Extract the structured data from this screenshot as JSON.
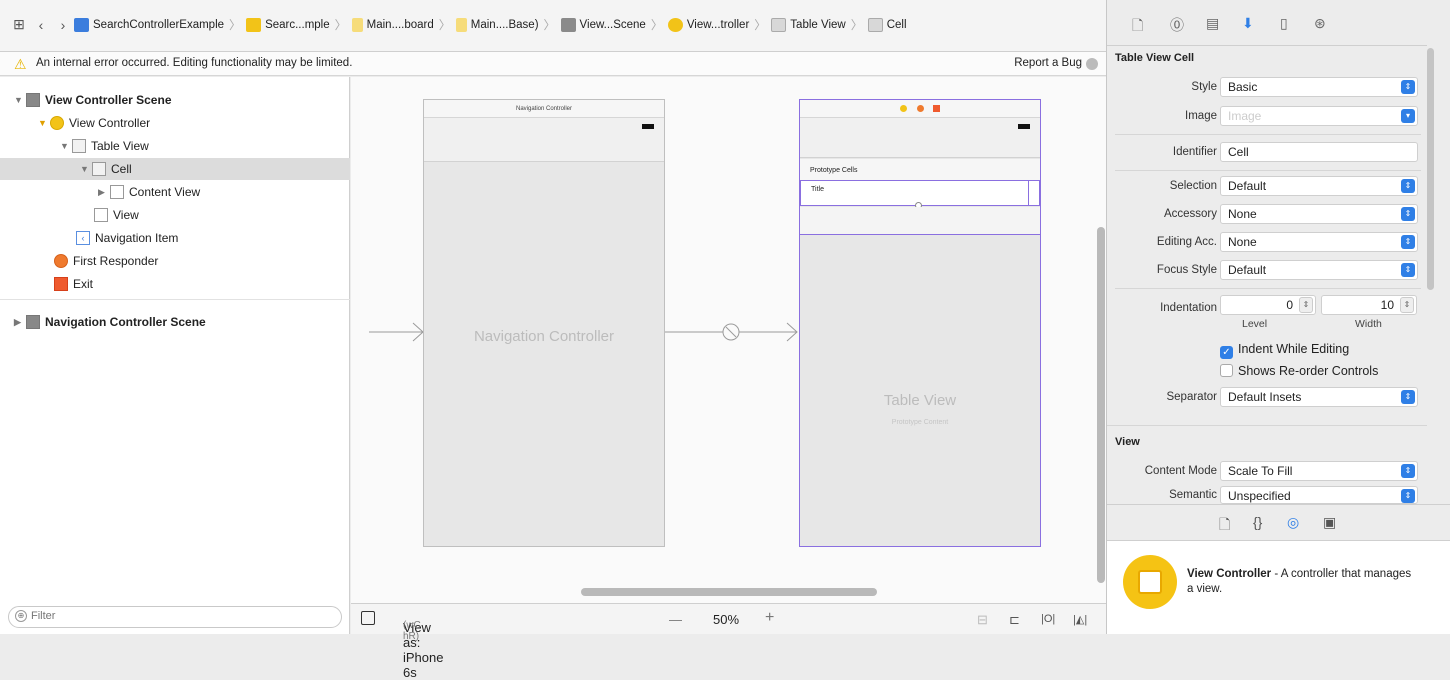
{
  "jumpbar": {
    "crumbs": [
      {
        "label": "SearchControllerExample",
        "color": "#3b7ddd"
      },
      {
        "label": "Searc...mple",
        "color": "#f2c318"
      },
      {
        "label": "Main....board",
        "color": "#f6dc7a"
      },
      {
        "label": "Main....Base)",
        "color": "#f6dc7a"
      },
      {
        "label": "View...Scene",
        "color": "#8a8a8a"
      },
      {
        "label": "View...troller",
        "color": "#f2c318"
      },
      {
        "label": "Table View",
        "color": "#d8d8d8"
      },
      {
        "label": "Cell",
        "color": "#d8d8d8"
      }
    ]
  },
  "warning": {
    "message": "An internal error occurred. Editing functionality may be limited.",
    "report": "Report a Bug"
  },
  "outline": {
    "items": [
      {
        "label": "View Controller Scene",
        "bold": true
      },
      {
        "label": "View Controller"
      },
      {
        "label": "Table View"
      },
      {
        "label": "Cell",
        "selected": true
      },
      {
        "label": "Content View"
      },
      {
        "label": "View"
      },
      {
        "label": "Navigation Item"
      },
      {
        "label": "First Responder"
      },
      {
        "label": "Exit"
      },
      {
        "label": "Navigation Controller Scene",
        "bold": true
      }
    ],
    "filter_placeholder": "Filter"
  },
  "canvas": {
    "nav_scene_title": "Navigation Controller",
    "nav_scene_label": "Navigation Controller",
    "prototype_cells": "Prototype Cells",
    "cell_title": "Title",
    "table_label": "Table View",
    "table_sub": "Prototype Content"
  },
  "bottombar": {
    "view_as": "View as: iPhone 6s",
    "size_class": "(wC hR)",
    "zoom_minus": "—",
    "zoom": "50%",
    "zoom_plus": "+"
  },
  "inspector": {
    "section_cell": "Table View Cell",
    "style_label": "Style",
    "style_value": "Basic",
    "image_label": "Image",
    "image_placeholder": "Image",
    "identifier_label": "Identifier",
    "identifier_value": "Cell",
    "selection_label": "Selection",
    "selection_value": "Default",
    "accessory_label": "Accessory",
    "accessory_value": "None",
    "editacc_label": "Editing Acc.",
    "editacc_value": "None",
    "focus_label": "Focus Style",
    "focus_value": "Default",
    "indent_label": "Indentation",
    "indent_level": "0",
    "indent_width": "10",
    "level_caption": "Level",
    "width_caption": "Width",
    "indent_while_editing": "Indent While Editing",
    "show_reorder": "Shows Re-order Controls",
    "separator_label": "Separator",
    "separator_value": "Default Insets",
    "section_view": "View",
    "content_mode_label": "Content Mode",
    "content_mode_value": "Scale To Fill",
    "semantic_label": "Semantic",
    "semantic_value": "Unspecified"
  },
  "library": {
    "title": "View Controller",
    "desc": " - A controller that manages a view."
  },
  "colors": {
    "accent": "#2f7fe6",
    "selection": "#8a6fe0",
    "warning": "#e6b400"
  }
}
